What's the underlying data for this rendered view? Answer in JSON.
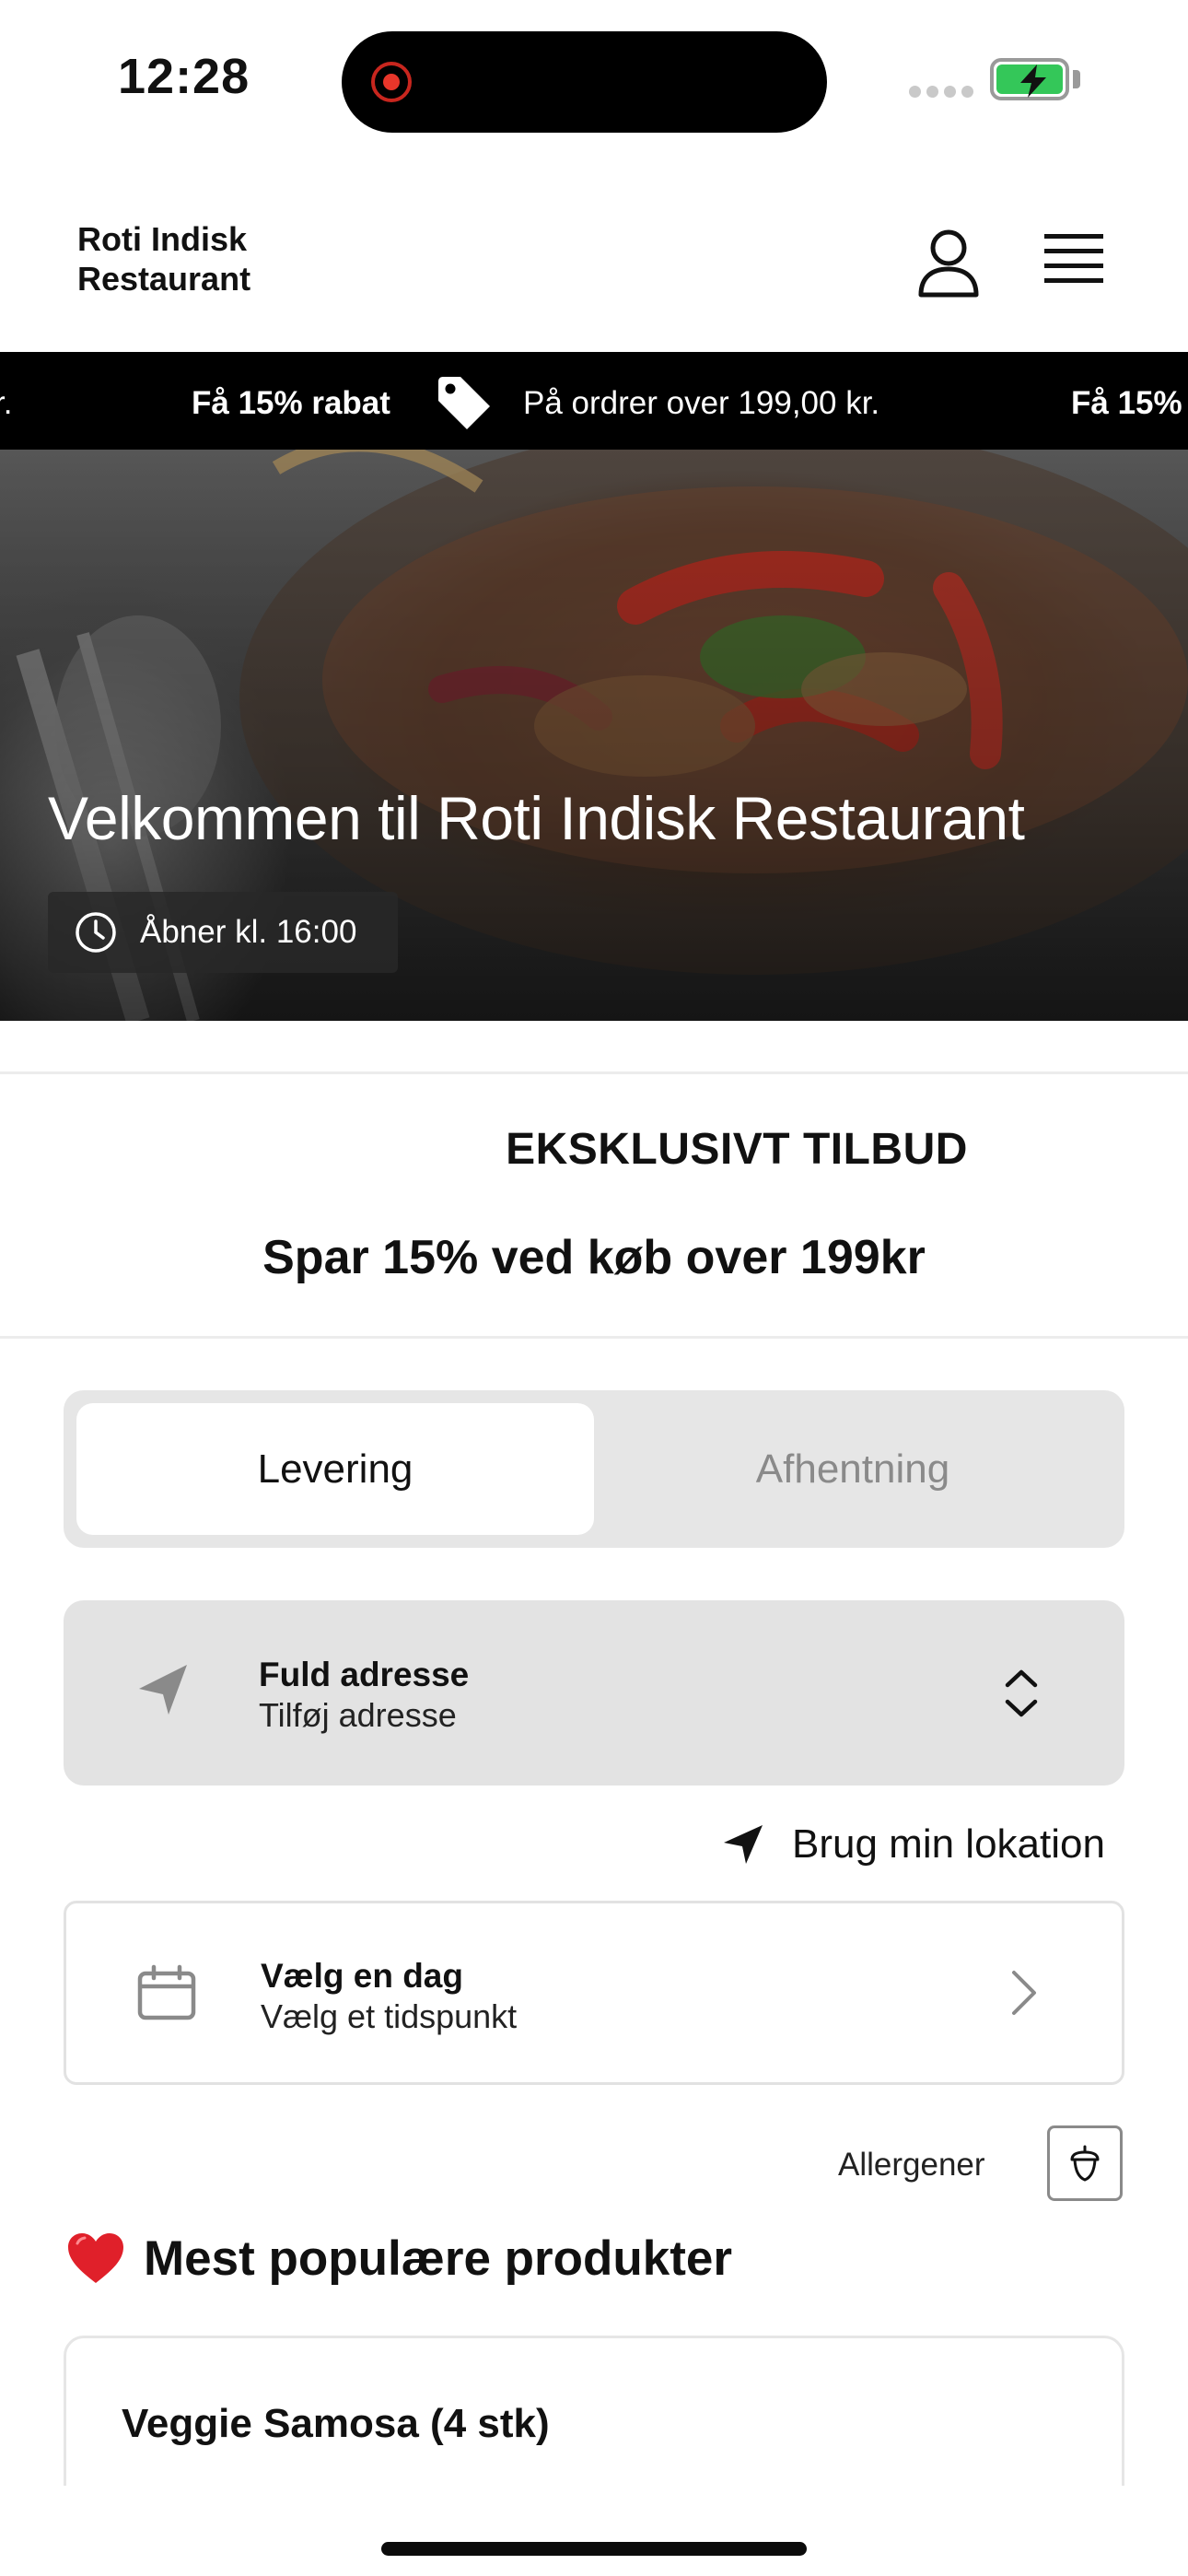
{
  "status_bar": {
    "time": "12:28",
    "battery_state": "charging",
    "accent_battery": "#34c759"
  },
  "header": {
    "brand_line1": "Roti Indisk",
    "brand_line2": "Restaurant",
    "profile_icon": "person-icon",
    "menu_icon": "hamburger-menu-icon"
  },
  "ticker": {
    "partial_left": "r.",
    "headline": "Få 15% rabat",
    "detail": "På ordrer over 199,00 kr.",
    "partial_right": "Få 15%",
    "icon": "price-tag-icon"
  },
  "hero": {
    "title": "Velkommen til Roti Indisk Restaurant",
    "hours": "Åbner kl. 16:00",
    "hours_icon": "clock-icon"
  },
  "promo": {
    "title": "EKSKLUSIVT TILBUD",
    "subtitle": "Spar 15% ved køb over 199kr"
  },
  "order_type": {
    "options": [
      "Levering",
      "Afhentning"
    ],
    "selected": "Levering"
  },
  "address": {
    "label": "Fuld adresse",
    "value": "Tilføj adresse",
    "icon": "navigation-arrow-icon",
    "toggle_icon": "chevron-up-down-icon"
  },
  "location": {
    "label": "Brug min lokation",
    "icon": "location-arrow-icon"
  },
  "schedule": {
    "label": "Vælg en dag",
    "value": "Vælg et tidspunkt",
    "icon": "calendar-icon",
    "chevron": "chevron-right-icon"
  },
  "allergens": {
    "label": "Allergener",
    "icon": "acorn-icon"
  },
  "popular": {
    "title": "Mest populære produkter",
    "icon": "heart-icon",
    "products": [
      {
        "name": "Veggie Samosa (4 stk)"
      }
    ]
  }
}
